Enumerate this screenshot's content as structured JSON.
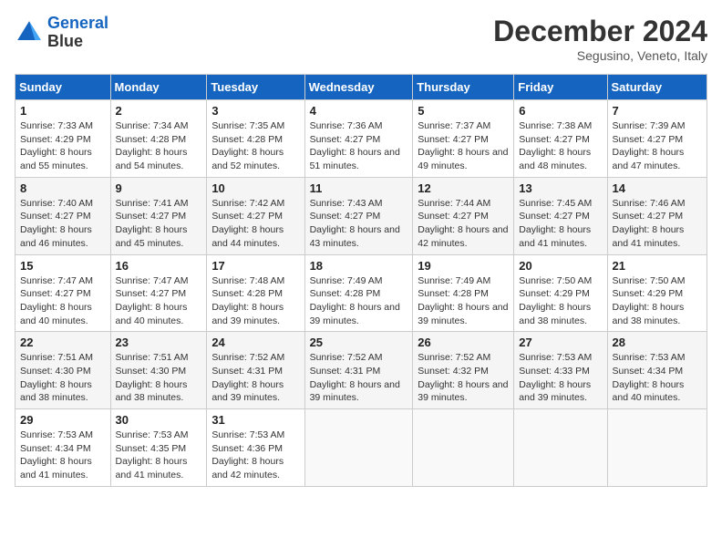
{
  "header": {
    "logo_line1": "General",
    "logo_line2": "Blue",
    "month": "December 2024",
    "location": "Segusino, Veneto, Italy"
  },
  "weekdays": [
    "Sunday",
    "Monday",
    "Tuesday",
    "Wednesday",
    "Thursday",
    "Friday",
    "Saturday"
  ],
  "weeks": [
    [
      {
        "day": "1",
        "sunrise": "Sunrise: 7:33 AM",
        "sunset": "Sunset: 4:29 PM",
        "daylight": "Daylight: 8 hours and 55 minutes."
      },
      {
        "day": "2",
        "sunrise": "Sunrise: 7:34 AM",
        "sunset": "Sunset: 4:28 PM",
        "daylight": "Daylight: 8 hours and 54 minutes."
      },
      {
        "day": "3",
        "sunrise": "Sunrise: 7:35 AM",
        "sunset": "Sunset: 4:28 PM",
        "daylight": "Daylight: 8 hours and 52 minutes."
      },
      {
        "day": "4",
        "sunrise": "Sunrise: 7:36 AM",
        "sunset": "Sunset: 4:27 PM",
        "daylight": "Daylight: 8 hours and 51 minutes."
      },
      {
        "day": "5",
        "sunrise": "Sunrise: 7:37 AM",
        "sunset": "Sunset: 4:27 PM",
        "daylight": "Daylight: 8 hours and 49 minutes."
      },
      {
        "day": "6",
        "sunrise": "Sunrise: 7:38 AM",
        "sunset": "Sunset: 4:27 PM",
        "daylight": "Daylight: 8 hours and 48 minutes."
      },
      {
        "day": "7",
        "sunrise": "Sunrise: 7:39 AM",
        "sunset": "Sunset: 4:27 PM",
        "daylight": "Daylight: 8 hours and 47 minutes."
      }
    ],
    [
      {
        "day": "8",
        "sunrise": "Sunrise: 7:40 AM",
        "sunset": "Sunset: 4:27 PM",
        "daylight": "Daylight: 8 hours and 46 minutes."
      },
      {
        "day": "9",
        "sunrise": "Sunrise: 7:41 AM",
        "sunset": "Sunset: 4:27 PM",
        "daylight": "Daylight: 8 hours and 45 minutes."
      },
      {
        "day": "10",
        "sunrise": "Sunrise: 7:42 AM",
        "sunset": "Sunset: 4:27 PM",
        "daylight": "Daylight: 8 hours and 44 minutes."
      },
      {
        "day": "11",
        "sunrise": "Sunrise: 7:43 AM",
        "sunset": "Sunset: 4:27 PM",
        "daylight": "Daylight: 8 hours and 43 minutes."
      },
      {
        "day": "12",
        "sunrise": "Sunrise: 7:44 AM",
        "sunset": "Sunset: 4:27 PM",
        "daylight": "Daylight: 8 hours and 42 minutes."
      },
      {
        "day": "13",
        "sunrise": "Sunrise: 7:45 AM",
        "sunset": "Sunset: 4:27 PM",
        "daylight": "Daylight: 8 hours and 41 minutes."
      },
      {
        "day": "14",
        "sunrise": "Sunrise: 7:46 AM",
        "sunset": "Sunset: 4:27 PM",
        "daylight": "Daylight: 8 hours and 41 minutes."
      }
    ],
    [
      {
        "day": "15",
        "sunrise": "Sunrise: 7:47 AM",
        "sunset": "Sunset: 4:27 PM",
        "daylight": "Daylight: 8 hours and 40 minutes."
      },
      {
        "day": "16",
        "sunrise": "Sunrise: 7:47 AM",
        "sunset": "Sunset: 4:27 PM",
        "daylight": "Daylight: 8 hours and 40 minutes."
      },
      {
        "day": "17",
        "sunrise": "Sunrise: 7:48 AM",
        "sunset": "Sunset: 4:28 PM",
        "daylight": "Daylight: 8 hours and 39 minutes."
      },
      {
        "day": "18",
        "sunrise": "Sunrise: 7:49 AM",
        "sunset": "Sunset: 4:28 PM",
        "daylight": "Daylight: 8 hours and 39 minutes."
      },
      {
        "day": "19",
        "sunrise": "Sunrise: 7:49 AM",
        "sunset": "Sunset: 4:28 PM",
        "daylight": "Daylight: 8 hours and 39 minutes."
      },
      {
        "day": "20",
        "sunrise": "Sunrise: 7:50 AM",
        "sunset": "Sunset: 4:29 PM",
        "daylight": "Daylight: 8 hours and 38 minutes."
      },
      {
        "day": "21",
        "sunrise": "Sunrise: 7:50 AM",
        "sunset": "Sunset: 4:29 PM",
        "daylight": "Daylight: 8 hours and 38 minutes."
      }
    ],
    [
      {
        "day": "22",
        "sunrise": "Sunrise: 7:51 AM",
        "sunset": "Sunset: 4:30 PM",
        "daylight": "Daylight: 8 hours and 38 minutes."
      },
      {
        "day": "23",
        "sunrise": "Sunrise: 7:51 AM",
        "sunset": "Sunset: 4:30 PM",
        "daylight": "Daylight: 8 hours and 38 minutes."
      },
      {
        "day": "24",
        "sunrise": "Sunrise: 7:52 AM",
        "sunset": "Sunset: 4:31 PM",
        "daylight": "Daylight: 8 hours and 39 minutes."
      },
      {
        "day": "25",
        "sunrise": "Sunrise: 7:52 AM",
        "sunset": "Sunset: 4:31 PM",
        "daylight": "Daylight: 8 hours and 39 minutes."
      },
      {
        "day": "26",
        "sunrise": "Sunrise: 7:52 AM",
        "sunset": "Sunset: 4:32 PM",
        "daylight": "Daylight: 8 hours and 39 minutes."
      },
      {
        "day": "27",
        "sunrise": "Sunrise: 7:53 AM",
        "sunset": "Sunset: 4:33 PM",
        "daylight": "Daylight: 8 hours and 39 minutes."
      },
      {
        "day": "28",
        "sunrise": "Sunrise: 7:53 AM",
        "sunset": "Sunset: 4:34 PM",
        "daylight": "Daylight: 8 hours and 40 minutes."
      }
    ],
    [
      {
        "day": "29",
        "sunrise": "Sunrise: 7:53 AM",
        "sunset": "Sunset: 4:34 PM",
        "daylight": "Daylight: 8 hours and 41 minutes."
      },
      {
        "day": "30",
        "sunrise": "Sunrise: 7:53 AM",
        "sunset": "Sunset: 4:35 PM",
        "daylight": "Daylight: 8 hours and 41 minutes."
      },
      {
        "day": "31",
        "sunrise": "Sunrise: 7:53 AM",
        "sunset": "Sunset: 4:36 PM",
        "daylight": "Daylight: 8 hours and 42 minutes."
      },
      null,
      null,
      null,
      null
    ]
  ]
}
